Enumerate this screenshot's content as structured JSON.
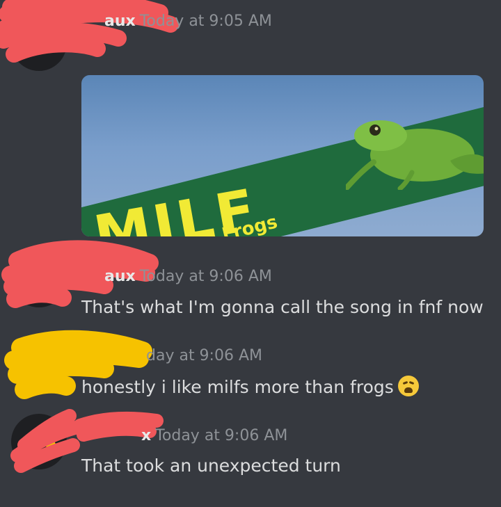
{
  "messages": [
    {
      "id": 1,
      "name_fragment": "aux",
      "timestamp": "Today at 9:05 AM",
      "text": ""
    },
    {
      "id": 2,
      "name_fragment": "aux",
      "timestamp": "Today at 9:06 AM",
      "text": "That's what I'm gonna call the song in fnf now"
    },
    {
      "id": 3,
      "name_fragment": "",
      "timestamp": "day at 9:06 AM",
      "text": "honestly i like milfs more than frogs",
      "emoji": "weary-face-emoji"
    },
    {
      "id": 4,
      "name_fragment": "x",
      "timestamp": "Today at 9:06 AM",
      "text": "That took an unexpected turn"
    }
  ],
  "attachment": {
    "headline": "MILF",
    "subline": "Man, I Love Frogs"
  },
  "colors": {
    "background": "#36393f",
    "text": "#dcddde",
    "muted": "#8e9297",
    "redaction_red": "#f0575a",
    "redaction_yellow": "#f6c200",
    "sign_green": "#1f6b3d",
    "sign_yellow": "#f1ea35"
  }
}
